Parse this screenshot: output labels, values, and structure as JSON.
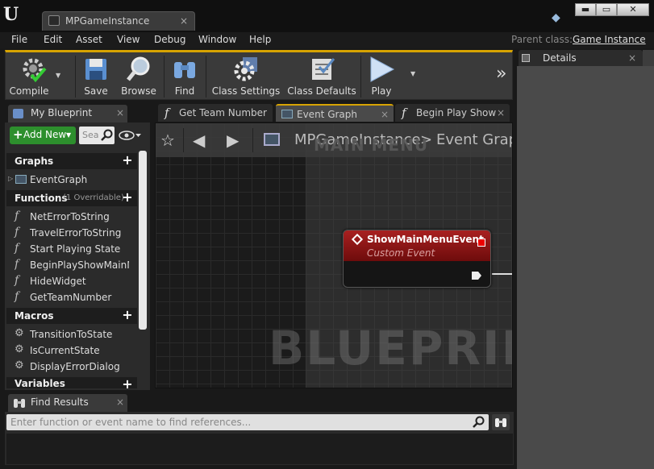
{
  "window": {
    "doc_tab": "MPGameInstance",
    "close_glyph": "×",
    "buttons": [
      "▬",
      "▭",
      "✕"
    ]
  },
  "menu": [
    "File",
    "Edit",
    "Asset",
    "View",
    "Debug",
    "Window",
    "Help"
  ],
  "parent_class": {
    "label": "Parent class:",
    "value": "Game Instance"
  },
  "toolbar": {
    "compile": "Compile",
    "save": "Save",
    "browse": "Browse",
    "find": "Find",
    "class_settings": "Class Settings",
    "class_defaults": "Class Defaults",
    "play": "Play",
    "dropdown_glyph": "▼",
    "more_glyph": "»"
  },
  "details": {
    "tab": "Details"
  },
  "my_blueprint": {
    "tab": "My Blueprint",
    "add_new": "Add New",
    "search_placeholder": "Sea",
    "sections": {
      "graphs": "Graphs",
      "functions": "Functions",
      "functions_note": "(1 Overridable)",
      "macros": "Macros",
      "variables": "Variables"
    },
    "graphs": [
      "EventGraph"
    ],
    "functions": [
      "NetErrorToString",
      "TravelErrorToString",
      "Start Playing State",
      "BeginPlayShowMainM",
      "HideWidget",
      "GetTeamNumber"
    ],
    "macros": [
      "TransitionToState",
      "IsCurrentState",
      "DisplayErrorDialog"
    ]
  },
  "graph_tabs": [
    {
      "label": "Get Team Number"
    },
    {
      "label": "Event Graph"
    },
    {
      "label": "Begin Play Show"
    }
  ],
  "graph": {
    "crumb_root": "MPGameInstance",
    "crumb_sep": ">",
    "crumb_current": "Event Graph",
    "comment": "MAIN MENU",
    "watermark": "BLUEPRINT",
    "node": {
      "title": "ShowMainMenuEvent",
      "subtitle": "Custom Event"
    }
  },
  "find_results": {
    "tab": "Find Results",
    "placeholder": "Enter function or event name to find references..."
  },
  "colors": {
    "accent": "#d7a300",
    "event_node": "#a82020",
    "add_new": "#2d8f2d"
  }
}
